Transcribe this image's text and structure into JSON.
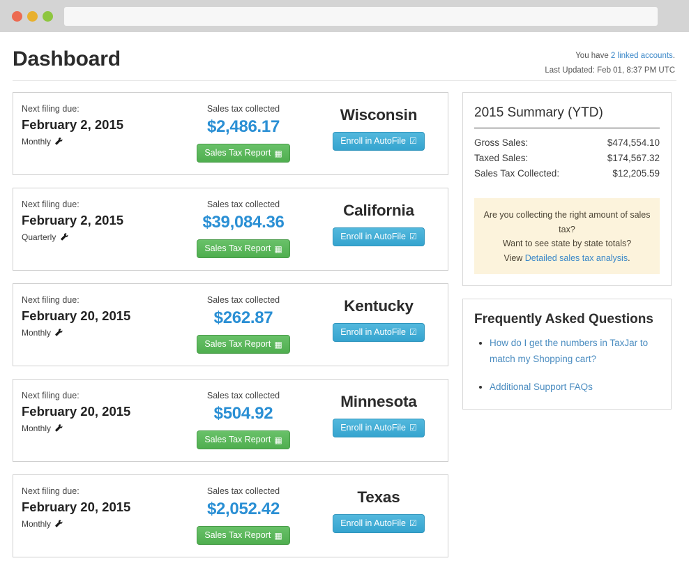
{
  "chrome": {
    "lights": [
      "close-red",
      "minimize-yellow",
      "maximize-green"
    ],
    "url_value": "",
    "url_placeholder": ""
  },
  "header": {
    "title": "Dashboard",
    "accounts_prefix": "You have ",
    "accounts_link": "2 linked accounts",
    "accounts_suffix": ".",
    "last_updated": "Last Updated: Feb 01, 8:37 PM UTC"
  },
  "labels": {
    "next_filing_due": "Next filing due:",
    "sales_tax_collected": "Sales tax collected",
    "report_button": "Sales Tax Report",
    "autofile_button": "Enroll in AutoFile",
    "report_icon": "list-alt-icon",
    "autofile_icon": "check-square-icon",
    "frequency_icon": "wrench-icon"
  },
  "states": [
    {
      "state": "Wisconsin",
      "due": "February 2, 2015",
      "frequency": "Monthly",
      "amount": "$2,486.17"
    },
    {
      "state": "California",
      "due": "February 2, 2015",
      "frequency": "Quarterly",
      "amount": "$39,084.36"
    },
    {
      "state": "Kentucky",
      "due": "February 20, 2015",
      "frequency": "Monthly",
      "amount": "$262.87"
    },
    {
      "state": "Minnesota",
      "due": "February 20, 2015",
      "frequency": "Monthly",
      "amount": "$504.92"
    },
    {
      "state": "Texas",
      "due": "February 20, 2015",
      "frequency": "Monthly",
      "amount": "$2,052.42"
    }
  ],
  "summary": {
    "title": "2015 Summary (YTD)",
    "rows": [
      {
        "label": "Gross Sales:",
        "value": "$474,554.10"
      },
      {
        "label": "Taxed Sales:",
        "value": "$174,567.32"
      },
      {
        "label": "Sales Tax Collected:",
        "value": "$12,205.59"
      }
    ],
    "notice_line1": "Are you collecting the right amount of sales tax?",
    "notice_line2": "Want to see state by state totals?",
    "notice_view": "View ",
    "notice_link": "Detailed sales tax analysis",
    "notice_end": "."
  },
  "faq": {
    "title": "Frequently Asked Questions",
    "items": [
      "How do I get the numbers in TaxJar to match my Shopping cart?",
      "Additional Support FAQs"
    ]
  },
  "colors": {
    "accent_blue": "#2a8fd4",
    "link_blue": "#3a87c8",
    "green_button": "#4fae4f",
    "blue_button": "#35a4cf",
    "notice_bg": "#fcf3dc"
  }
}
